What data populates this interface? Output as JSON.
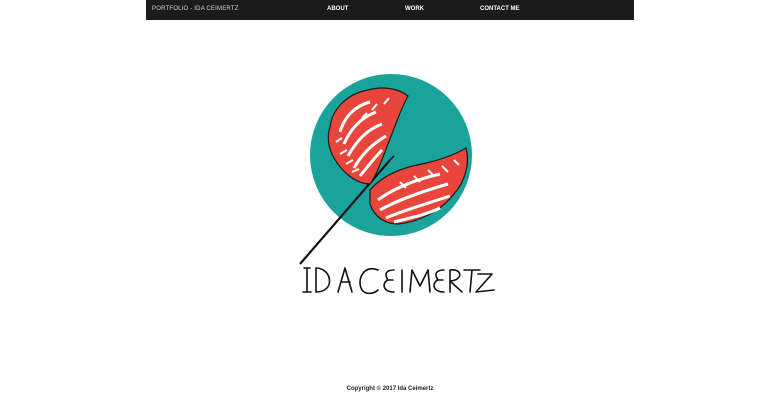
{
  "nav": {
    "brand": "PORTFOLIO - IDA CEIMERTZ",
    "about": "ABOUT",
    "work": "WORK",
    "contact": "CONTACT ME"
  },
  "logo": {
    "signature_text": "Ida Ceimertz",
    "circle_color": "#1aa39a",
    "wing_color": "#e8463c",
    "icon": "winged-dart-logo"
  },
  "footer": {
    "copyright": "Copyright © 2017 Ida Ceimertz"
  },
  "colors": {
    "topbar": "#1b1b1b",
    "background": "#ffffff"
  }
}
